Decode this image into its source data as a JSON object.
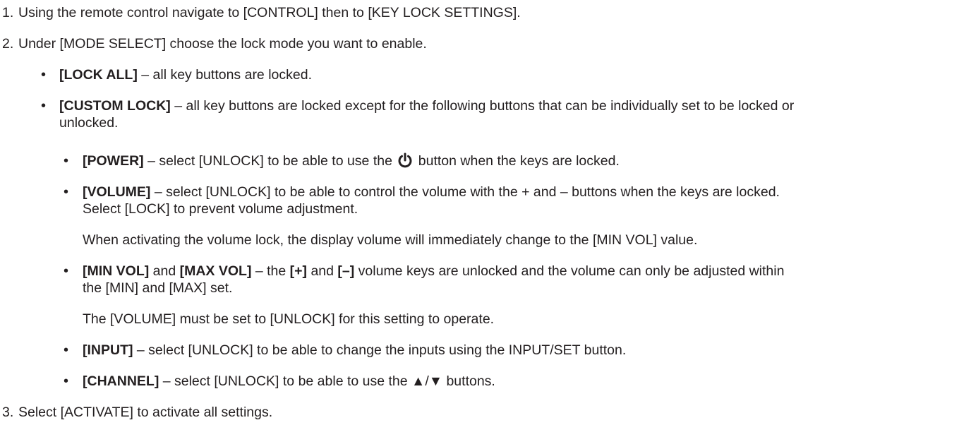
{
  "steps": [
    {
      "number": "1.",
      "text": "Using the remote control navigate to [CONTROL] then to [KEY LOCK SETTINGS]."
    },
    {
      "number": "2.",
      "text": "Under [MODE SELECT] choose the lock mode you want to enable."
    },
    {
      "number": "3.",
      "text": "Select [ACTIVATE] to activate all settings."
    }
  ],
  "modes": {
    "lock_all": {
      "label": "[LOCK ALL]",
      "desc": " – all key buttons are locked."
    },
    "custom_lock": {
      "label": "[CUSTOM LOCK]",
      "desc_line1": " – all key buttons are locked except for the following buttons that can be individually set to be locked or",
      "desc_line2": "unlocked."
    }
  },
  "custom_items": {
    "power": {
      "label": "[POWER]",
      "pre": " – select [UNLOCK] to be able to use the",
      "post": "button when the keys are locked.",
      "icon": "power-icon"
    },
    "volume": {
      "label": "[VOLUME]",
      "line1": " – select [UNLOCK] to be able to control the volume with the + and – buttons when the keys are locked.",
      "line2": "Select [LOCK] to prevent volume adjustment.",
      "note": "When activating the volume lock, the display volume will immediately change to the [MIN VOL] value."
    },
    "minmax": {
      "label1": "[MIN VOL]",
      "and": " and ",
      "label2": "[MAX VOL]",
      "mid1": " – the ",
      "key_plus": "[+]",
      "and2": " and ",
      "key_minus": "[–]",
      "rest1": " volume keys are unlocked and the volume can only be adjusted within",
      "line2": "the [MIN] and [MAX] set.",
      "note": "The [VOLUME] must be set to [UNLOCK] for this setting to operate."
    },
    "input": {
      "label": "[INPUT]",
      "desc": " – select [UNLOCK] to be able to change the inputs using the INPUT/SET button."
    },
    "channel": {
      "label": "[CHANNEL]",
      "desc": " – select [UNLOCK] to be able to use the ▲/▼ buttons."
    }
  }
}
